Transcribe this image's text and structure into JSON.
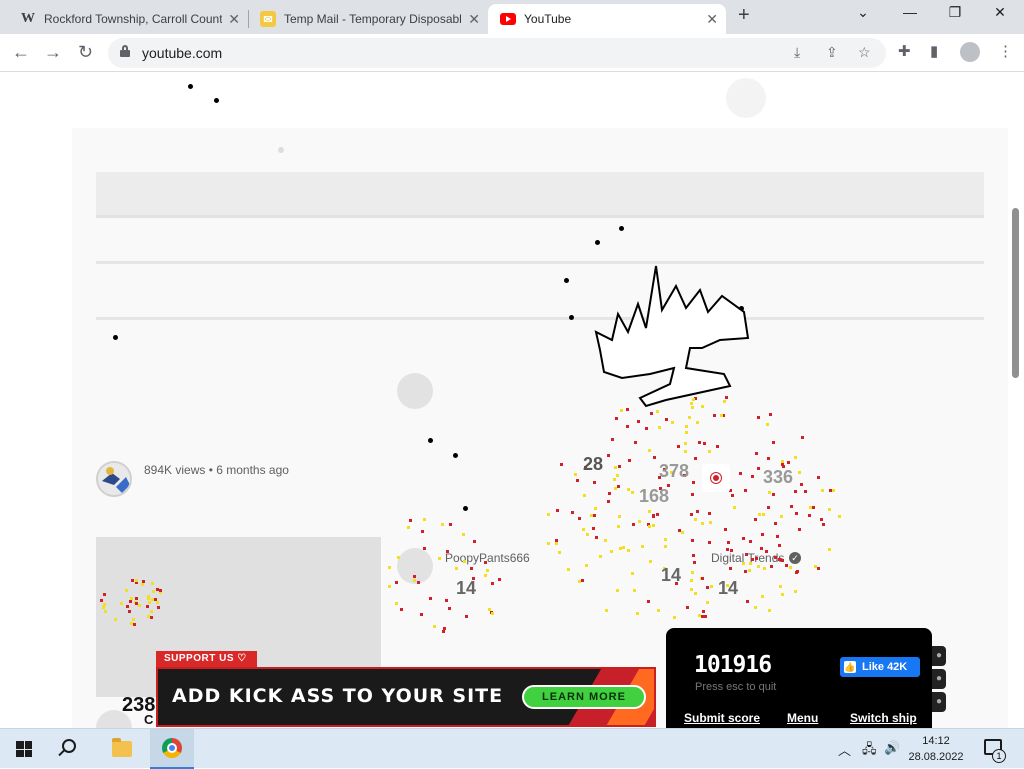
{
  "browser": {
    "tabs": [
      {
        "title": "Rockford Township, Carroll County",
        "favicon": "W"
      },
      {
        "title": "Temp Mail - Temporary Disposable",
        "favicon": "tempmail-icon"
      },
      {
        "title": "YouTube",
        "favicon": "youtube-icon"
      }
    ],
    "address": "youtube.com",
    "new_tab": "+",
    "window_controls": {
      "dropdown": "⌄",
      "minimize": "—",
      "restore": "❐",
      "close": "✕"
    }
  },
  "youtube": {
    "views_meta": "894K views • 6 months ago",
    "channel_a": "PoopyPants666",
    "channel_b": "Digital Trends",
    "partial_count": "238",
    "partial_text": "C"
  },
  "game": {
    "overlay_numbers": [
      "28",
      "378",
      "336",
      "168",
      "14",
      "14",
      "14"
    ],
    "score": "101916",
    "hint": "Press esc to quit",
    "facebook_like": "Like 42K",
    "links": [
      "Submit score",
      "Menu",
      "Switch ship"
    ]
  },
  "ad": {
    "tag": "SUPPORT US ♡",
    "headline": "ADD KICK ASS TO YOUR SITE",
    "button": "LEARN MORE"
  },
  "taskbar": {
    "time": "14:12",
    "date": "28.08.2022",
    "notifications": "1"
  },
  "colors": {
    "youtube_red": "#ff0000",
    "spark_red": "#d0202a",
    "spark_yellow": "#f0e020",
    "ad_green": "#40d040",
    "fb_blue": "#1877f2"
  }
}
